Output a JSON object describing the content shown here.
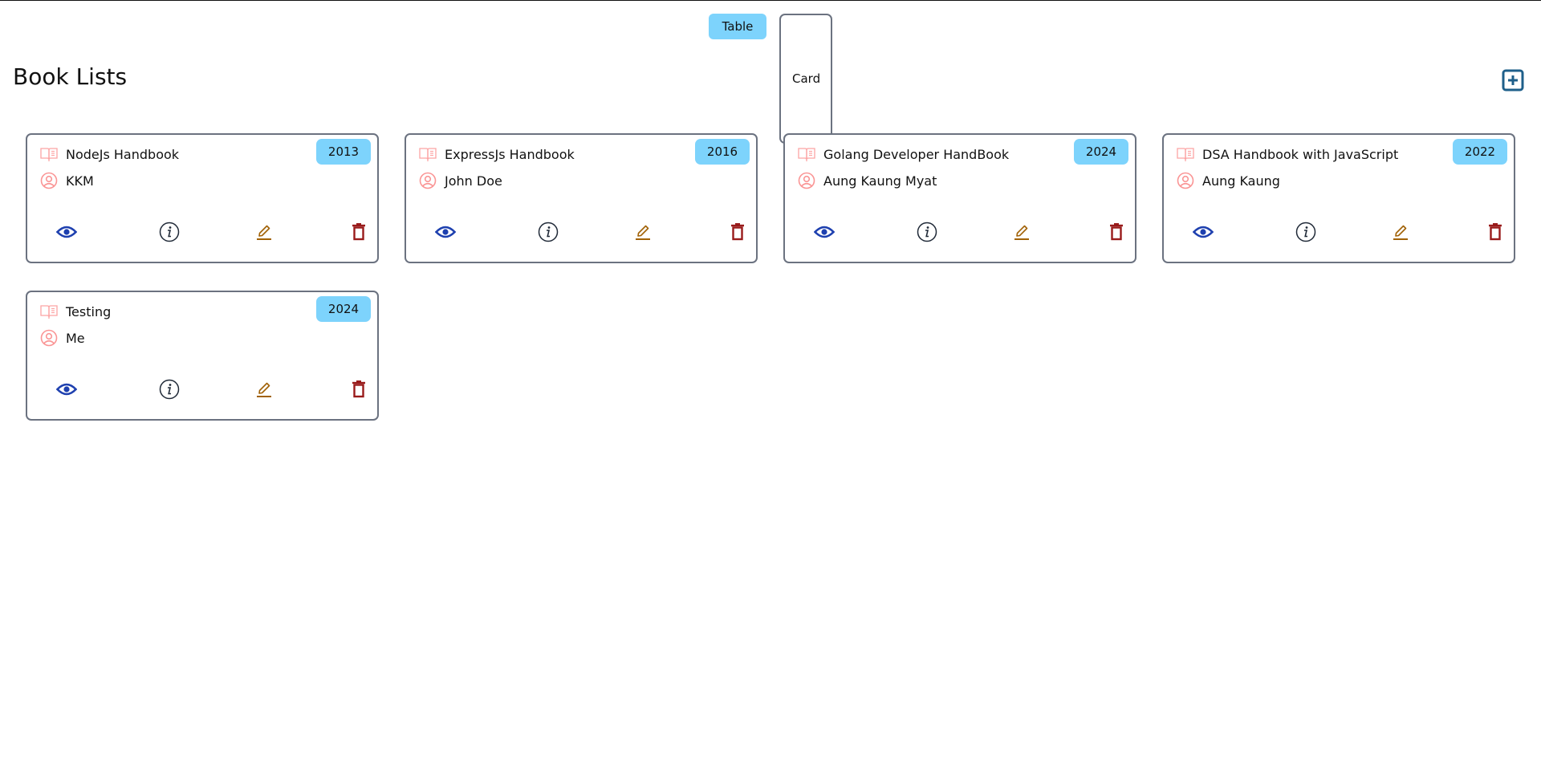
{
  "view_toggle": {
    "table_label": "Table",
    "card_label": "Card"
  },
  "header": {
    "title": "Book Lists",
    "add_icon": "plus-square-icon"
  },
  "colors": {
    "badge_bg": "#7dd3fc",
    "view_icon": "#1e40af",
    "info_icon": "#1f2937",
    "edit_icon": "#a16207",
    "delete_icon": "#991b1b",
    "book_icon": "#fca5a5",
    "author_icon": "#f87171",
    "add_icon": "#1e5f8a",
    "card_border": "#6b7280"
  },
  "icons": {
    "title": "book-open-icon",
    "author": "user-circle-icon",
    "actions": [
      "eye-icon",
      "info-icon",
      "pencil-icon",
      "trash-icon"
    ]
  },
  "books": [
    {
      "title": "NodeJs Handbook",
      "author": "KKM",
      "year": "2013"
    },
    {
      "title": "ExpressJs Handbook",
      "author": "John Doe",
      "year": "2016"
    },
    {
      "title": "Golang Developer HandBook",
      "author": "Aung Kaung Myat",
      "year": "2024"
    },
    {
      "title": "DSA Handbook with JavaScript",
      "author": "Aung Kaung",
      "year": "2022"
    },
    {
      "title": "Testing",
      "author": "Me",
      "year": "2024"
    }
  ]
}
